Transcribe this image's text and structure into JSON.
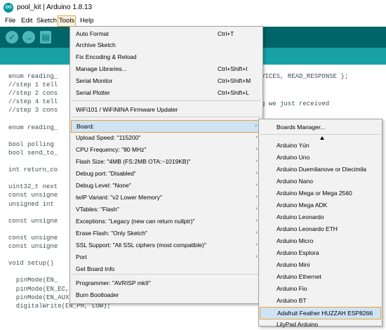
{
  "window": {
    "title": "pool_kit | Arduino 1.8.13",
    "app_icon_text": "OO"
  },
  "menubar": {
    "items": [
      "File",
      "Edit",
      "Sketch",
      "Tools",
      "Help"
    ],
    "active": "Tools"
  },
  "toolbar": {
    "buttons": [
      {
        "name": "verify",
        "glyph": "✓"
      },
      {
        "name": "upload",
        "glyph": "→"
      },
      {
        "name": "new",
        "glyph": "▤"
      }
    ]
  },
  "code": {
    "lines": [
      "enum reading_",
      "//step 1 tell",
      "//step 2 cons",
      "//step 4 tell",
      "//step 3 cons",
      "",
      "enum reading_",
      "",
      "bool polling",
      "bool send_to_",
      "",
      "int return_co",
      "",
      "uint32_t next",
      "const unsigne",
      "unsigned int ",
      "",
      "const unsigne",
      "",
      "const unsigne",
      "const unsigne",
      "",
      "void setup()",
      "",
      "  pinMode(EN_",
      "  pinMode(EN_EC, OUTPUT);",
      "  pinMode(EN_AUX, OUTPUT);",
      "  digitalWrite(EN_PH, LOW);"
    ],
    "right_fragments": [
      "VICES, READ_RESPONSE };",
      "g we just received"
    ]
  },
  "tools_menu": {
    "items": [
      {
        "label": "Auto Format",
        "shortcut": "Ctrl+T"
      },
      {
        "label": "Archive Sketch",
        "shortcut": ""
      },
      {
        "label": "Fix Encoding & Reload",
        "shortcut": ""
      },
      {
        "label": "Manage Libraries...",
        "shortcut": "Ctrl+Shift+I"
      },
      {
        "label": "Serial Monitor",
        "shortcut": "Ctrl+Shift+M"
      },
      {
        "label": "Serial Plotter",
        "shortcut": "Ctrl+Shift+L"
      },
      {
        "label": "WiFi101 / WiFiNINA Firmware Updater",
        "shortcut": ""
      },
      {
        "label": "Board: ",
        "shortcut": ""
      },
      {
        "label": "Upload Speed: \"115200\"",
        "shortcut": ""
      },
      {
        "label": "CPU Frequency: \"80 MHz\"",
        "shortcut": ""
      },
      {
        "label": "Flash Size: \"4MB (FS:2MB OTA:~1019KB)\"",
        "shortcut": ""
      },
      {
        "label": "Debug port: \"Disabled\"",
        "shortcut": ""
      },
      {
        "label": "Debug Level: \"None\"",
        "shortcut": ""
      },
      {
        "label": "lwIP Variant: \"v2 Lower Memory\"",
        "shortcut": ""
      },
      {
        "label": "VTables: \"Flash\"",
        "shortcut": ""
      },
      {
        "label": "Exceptions: \"Legacy (new can return nullptr)\"",
        "shortcut": ""
      },
      {
        "label": "Erase Flash: \"Only Sketch\"",
        "shortcut": ""
      },
      {
        "label": "SSL Support: \"All SSL ciphers (most compatible)\"",
        "shortcut": ""
      },
      {
        "label": "Port",
        "shortcut": ""
      },
      {
        "label": "Get Board Info",
        "shortcut": ""
      },
      {
        "label": "Programmer: \"AVRISP mkII\"",
        "shortcut": ""
      },
      {
        "label": "Burn Bootloader",
        "shortcut": ""
      }
    ],
    "highlighted": "Board: "
  },
  "board_menu": {
    "items": [
      "Boards Manager...",
      "Arduino Yún",
      "Arduino Uno",
      "Arduino Duemilanove or Diecimila",
      "Arduino Nano",
      "Arduino Mega or Mega 2560",
      "Arduino Mega ADK",
      "Arduino Leonardo",
      "Arduino Leonardo ETH",
      "Arduino Micro",
      "Arduino Esplora",
      "Arduino Mini",
      "Arduino Ethernet",
      "Arduino Fio",
      "Arduino BT",
      "Adafruit Feather HUZZAH ESP8266",
      "LilyPad Arduino"
    ],
    "selected": "Adafruit Feather HUZZAH ESP8266"
  },
  "colors": {
    "toolbar": "#006468",
    "tabstrip": "#17a1a5",
    "highlight_border": "#e3a43a",
    "highlight_fill": "#cfe3f5"
  }
}
